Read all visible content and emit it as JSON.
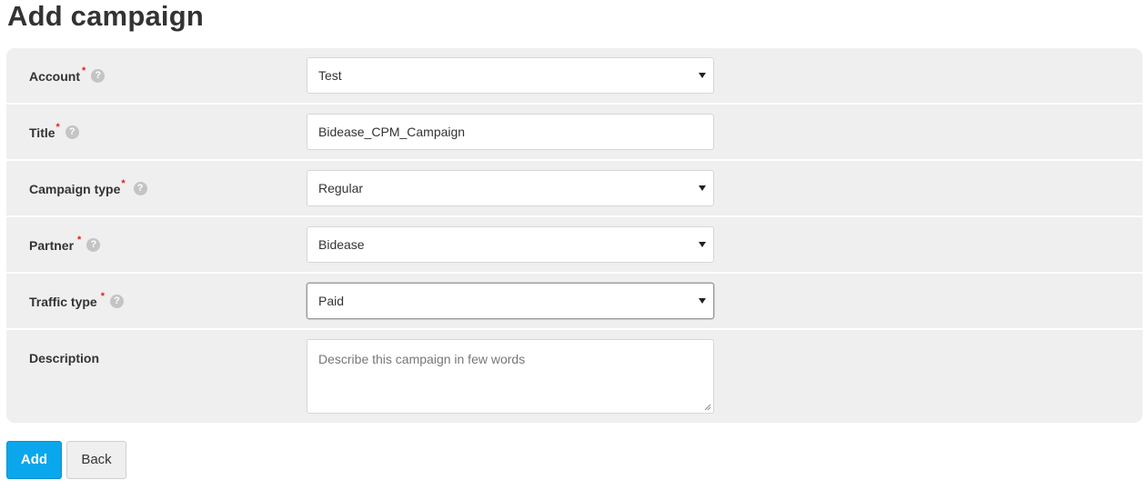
{
  "page": {
    "title": "Add campaign"
  },
  "form": {
    "account": {
      "label": "Account",
      "required": "*",
      "value": "Test"
    },
    "title": {
      "label": "Title",
      "required": "*",
      "value": "Bidease_CPM_Campaign"
    },
    "campaign_type": {
      "label": "Campaign type",
      "required": "*",
      "value": "Regular"
    },
    "partner": {
      "label": "Partner",
      "required": "*",
      "value": "Bidease"
    },
    "traffic_type": {
      "label": "Traffic type",
      "required": "*",
      "value": "Paid"
    },
    "description": {
      "label": "Description",
      "placeholder": "Describe this campaign in few words"
    }
  },
  "help_icon": {
    "glyph": "?"
  },
  "buttons": {
    "add": "Add",
    "back": "Back"
  },
  "colors": {
    "primary": "#0aa7ec",
    "required": "#e02020",
    "panel": "#efefef"
  },
  "icons": {
    "help": "question-circle-icon",
    "dropdown": "caret-down-icon"
  }
}
